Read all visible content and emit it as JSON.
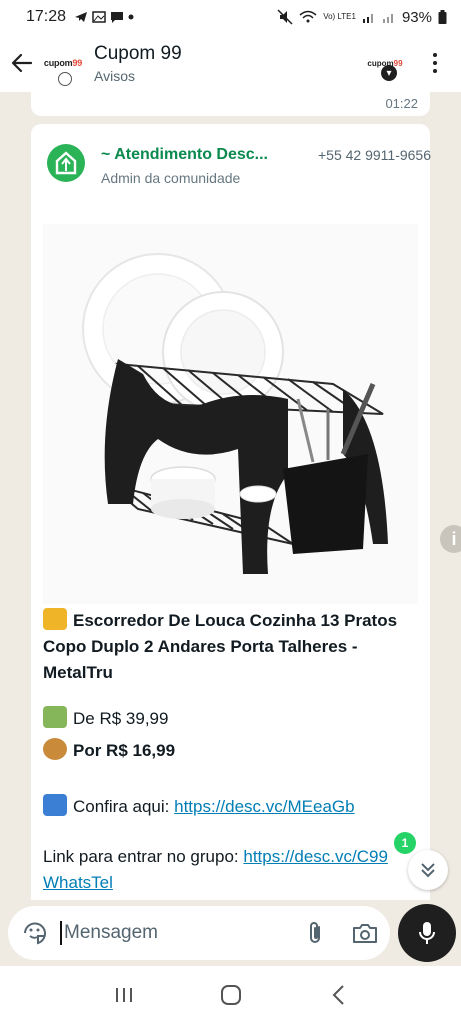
{
  "status_bar": {
    "time": "17:28",
    "network": "Vo) LTE1",
    "battery": "93%"
  },
  "header": {
    "title": "Cupom 99",
    "subtitle": "Avisos",
    "logo_text": "cupom",
    "logo_accent": "99"
  },
  "previous_message": {
    "time": "01:22"
  },
  "message": {
    "sender_name": "~ Atendimento Desc...",
    "sender_phone": "+55 42 9911-9656",
    "sender_role": "Admin da comunidade",
    "product_title": "Escorredor De Louca Cozinha 13 Pratos Copo Duplo 2 Andares Porta Talheres - MetalTru",
    "price_from_label": "De R$ 39,99",
    "price_now_label": "Por R$ 16,99",
    "check_label": "Confira aqui:",
    "check_link": "https://desc.vc/MEeaGb",
    "group_label": "Link para entrar no grupo:",
    "group_link": "https://desc.vc/C99WhatsTel"
  },
  "unread_count": "1",
  "input": {
    "placeholder": "Mensagem"
  },
  "colors": {
    "accent_green": "#25d366",
    "sender_green": "#0a8a4e",
    "link_blue": "#027eb5",
    "chat_bg": "#efeae2"
  }
}
